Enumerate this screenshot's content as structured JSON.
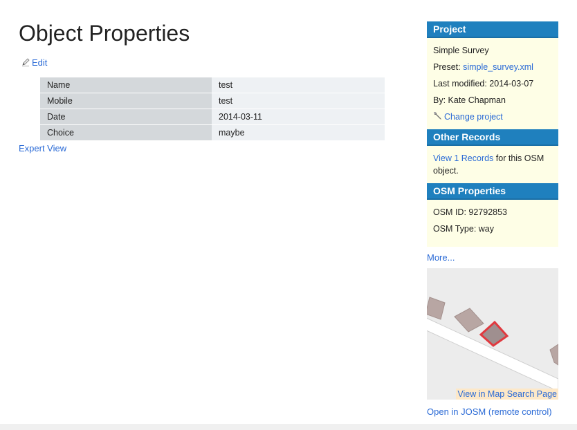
{
  "page": {
    "title": "Object Properties",
    "edit_label": "Edit",
    "expert_view_label": "Expert View"
  },
  "properties": [
    {
      "key": "Name",
      "value": "test"
    },
    {
      "key": "Mobile",
      "value": "test"
    },
    {
      "key": "Date",
      "value": "2014-03-11"
    },
    {
      "key": "Choice",
      "value": "maybe"
    }
  ],
  "sidebar": {
    "project": {
      "heading": "Project",
      "name": "Simple Survey",
      "preset_label": "Preset: ",
      "preset_link": "simple_survey.xml",
      "last_modified": "Last modified: 2014-03-07",
      "by": "By: Kate Chapman",
      "change_project_label": "Change project"
    },
    "other_records": {
      "heading": "Other Records",
      "view_link": "View 1 Records",
      "suffix": " for this OSM object."
    },
    "osm_properties": {
      "heading": "OSM Properties",
      "osm_id": "OSM ID: 92792853",
      "osm_type": "OSM Type: way"
    },
    "more_label": "More...",
    "map_link_label": "View in Map Search Page",
    "josm_link_label": "Open in JOSM (remote control)"
  },
  "colors": {
    "link": "#2a6ad6",
    "box_header": "#1f80be",
    "box_body": "#fefee6",
    "selected_building": "#e0393f"
  },
  "icons": [
    "pencil-icon",
    "wrench-icon"
  ]
}
